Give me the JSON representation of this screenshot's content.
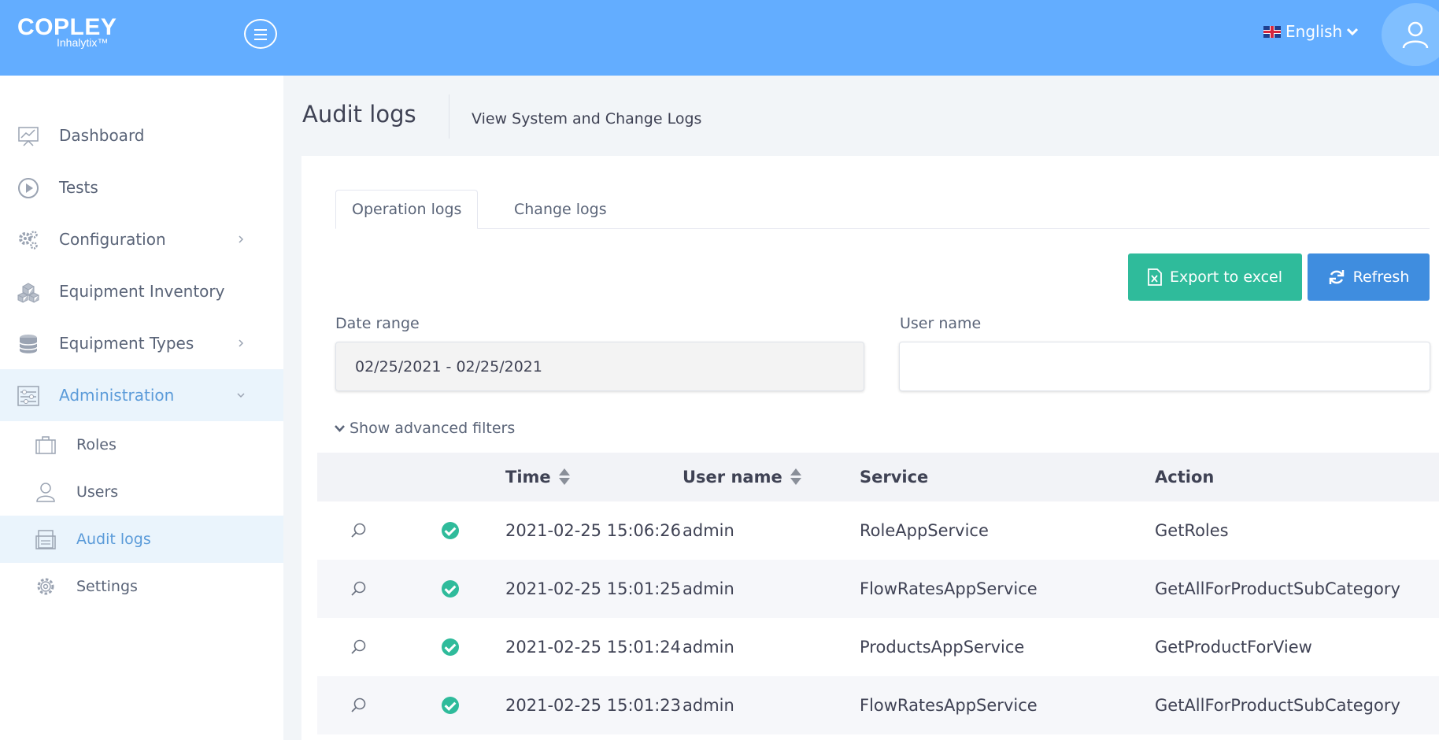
{
  "header": {
    "brand": "COPLEY",
    "brand_sub": "Inhalytix™",
    "language": "English"
  },
  "sidebar": {
    "items": [
      {
        "label": "Dashboard",
        "icon": "chart-icon"
      },
      {
        "label": "Tests",
        "icon": "play-icon"
      },
      {
        "label": "Configuration",
        "icon": "gears-icon"
      },
      {
        "label": "Equipment Inventory",
        "icon": "boxes-icon"
      },
      {
        "label": "Equipment Types",
        "icon": "database-icon"
      },
      {
        "label": "Administration",
        "icon": "sliders-icon"
      }
    ],
    "sub_items": [
      {
        "label": "Roles",
        "icon": "briefcase-icon"
      },
      {
        "label": "Users",
        "icon": "user-icon"
      },
      {
        "label": "Audit logs",
        "icon": "log-icon"
      },
      {
        "label": "Settings",
        "icon": "gear-icon"
      }
    ]
  },
  "page": {
    "title": "Audit logs",
    "subtitle": "View System and Change Logs"
  },
  "tabs": [
    "Operation logs",
    "Change logs"
  ],
  "buttons": {
    "export": "Export to excel",
    "refresh": "Refresh"
  },
  "filters": {
    "date_label": "Date range",
    "date_value": "02/25/2021 - 02/25/2021",
    "user_label": "User name",
    "user_value": "",
    "advanced": "Show advanced filters"
  },
  "table": {
    "columns": [
      "Time",
      "User name",
      "Service",
      "Action"
    ],
    "rows": [
      {
        "time": "2021-02-25 15:06:26",
        "user": "admin",
        "service": "RoleAppService",
        "action": "GetRoles"
      },
      {
        "time": "2021-02-25 15:01:25",
        "user": "admin",
        "service": "FlowRatesAppService",
        "action": "GetAllForProductSubCategory"
      },
      {
        "time": "2021-02-25 15:01:24",
        "user": "admin",
        "service": "ProductsAppService",
        "action": "GetProductForView"
      },
      {
        "time": "2021-02-25 15:01:23",
        "user": "admin",
        "service": "FlowRatesAppService",
        "action": "GetAllForProductSubCategory"
      }
    ]
  },
  "colors": {
    "header_bg": "#63adff",
    "accent_green": "#2fbb9b",
    "accent_blue": "#3f8ddf",
    "active_nav": "#eaf4fc"
  }
}
